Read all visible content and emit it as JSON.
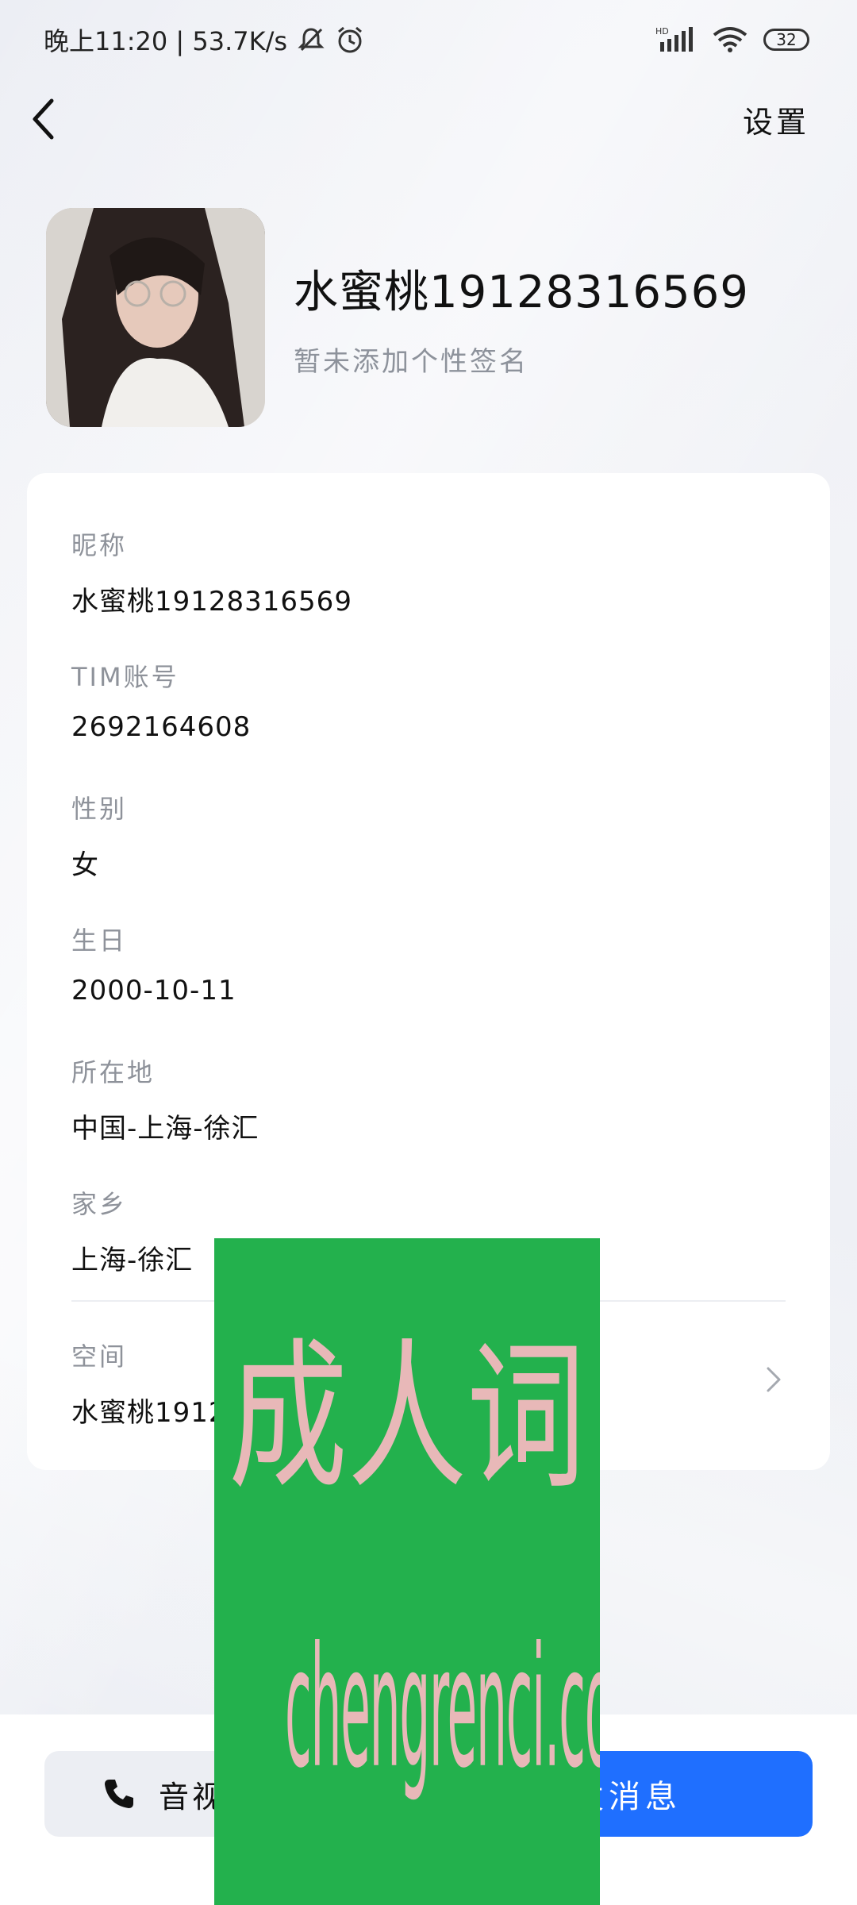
{
  "status_bar": {
    "time_speed": "晚上11:20 | 53.7K/s",
    "network": "HD",
    "battery": "32",
    "icons": [
      "mute-bell-icon",
      "alarm-icon",
      "signal-icon",
      "wifi-icon",
      "battery-icon"
    ]
  },
  "nav": {
    "back_icon": "chevron-left-icon",
    "settings_label": "设置"
  },
  "profile": {
    "name": "水蜜桃19128316569",
    "signature": "暂未添加个性签名"
  },
  "fields": [
    {
      "label": "昵称",
      "value": "水蜜桃19128316569"
    },
    {
      "label": "TIM账号",
      "value": "2692164608"
    },
    {
      "label": "性别",
      "value": "女"
    },
    {
      "label": "生日",
      "value": "2000-10-11"
    },
    {
      "label": "所在地",
      "value": "中国-上海-徐汇"
    },
    {
      "label": "家乡",
      "value": "上海-徐汇"
    },
    {
      "label": "空间",
      "value": "水蜜桃1912"
    }
  ],
  "actions": {
    "call_label": "音视",
    "message_label": "发消息",
    "call_icon": "phone-icon"
  },
  "overlay": {
    "text_cn": "成人词",
    "text_en": "chengrenci.com"
  },
  "colors": {
    "accent": "#1f6fff",
    "overlay_green": "#23b14d",
    "muted_text": "#8e929a"
  }
}
